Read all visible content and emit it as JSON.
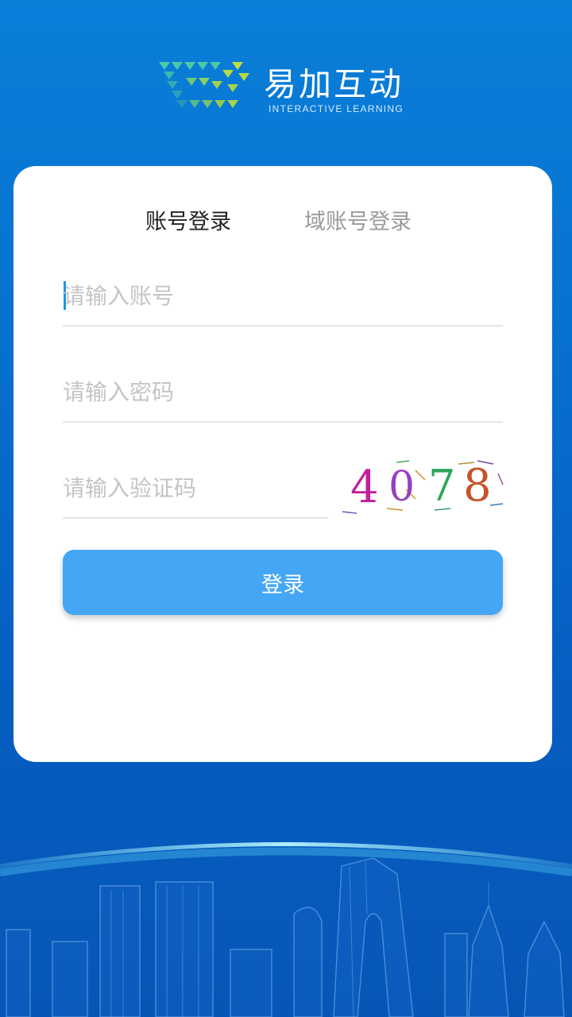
{
  "brand": {
    "title": "易加互动",
    "subtitle": "INTERACTIVE LEARNING"
  },
  "tabs": [
    {
      "label": "账号登录",
      "active": true
    },
    {
      "label": "域账号登录",
      "active": false
    }
  ],
  "form": {
    "account_placeholder": "请输入账号",
    "password_placeholder": "请输入密码",
    "captcha_placeholder": "请输入验证码",
    "captcha_code": [
      "4",
      "0",
      "7",
      "8"
    ]
  },
  "login_button": "登录",
  "colors": {
    "primary_button": "#45a6f5",
    "background": "#0770cf",
    "captcha_digits": [
      "#c21e9e",
      "#9a3fbf",
      "#2aa45a",
      "#c4552a"
    ]
  }
}
